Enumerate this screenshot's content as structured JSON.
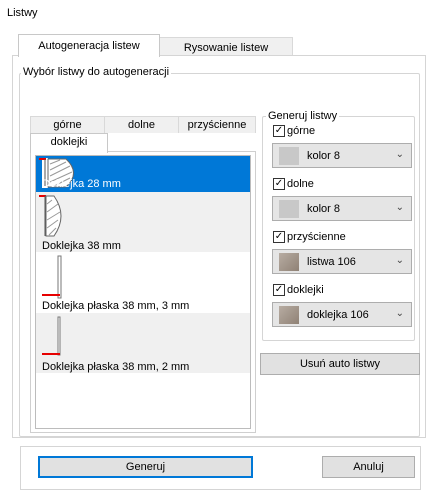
{
  "window": {
    "title": "Listwy"
  },
  "main_tabs": [
    {
      "label": "Autogeneracja listew",
      "active": true
    },
    {
      "label": "Rysowanie listew",
      "active": false
    }
  ],
  "group": {
    "legend": "Wybór listwy do autogeneracji"
  },
  "sub_tabs": [
    {
      "label": "górne"
    },
    {
      "label": "dolne"
    },
    {
      "label": "przyścienne"
    },
    {
      "label": "doklejki",
      "active": true
    }
  ],
  "list_items": [
    {
      "label": "Doklejka 28 mm",
      "selected": true
    },
    {
      "label": "Doklejka 38 mm",
      "selected": false
    },
    {
      "label": "Doklejka płaska 38 mm, 3 mm",
      "selected": false
    },
    {
      "label": "Doklejka płaska 38 mm, 2 mm",
      "selected": false
    }
  ],
  "generate": {
    "legend": "Generuj listwy",
    "options": [
      {
        "label": "górne",
        "checked": true,
        "value": "kolor 8",
        "swatch_color": "#c8c8c8"
      },
      {
        "label": "dolne",
        "checked": true,
        "value": "kolor 8",
        "swatch_color": "#c8c8c8"
      },
      {
        "label": "przyścienne",
        "checked": true,
        "value": "listwa 106",
        "swatch_color": "#a89a8e"
      },
      {
        "label": "doklejki",
        "checked": true,
        "value": "doklejka 106",
        "swatch_color": "#a89a8e"
      }
    ],
    "remove_button": "Usuń auto listwy"
  },
  "footer": {
    "generate_button": "Generuj",
    "cancel_button": "Anuluj"
  },
  "check_glyph": "✓",
  "chevron_glyph": "⌄"
}
